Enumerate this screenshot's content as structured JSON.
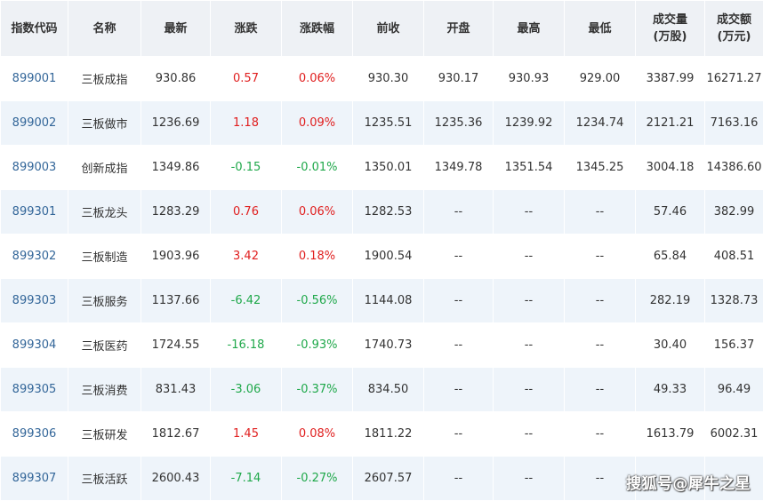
{
  "colors": {
    "up": "#e01e1e",
    "down": "#1fa84a",
    "code": "#336699",
    "header_bg": "#eef1f5",
    "stripe_bg": "#eef4fa"
  },
  "headers": [
    [
      "指数代码"
    ],
    [
      "名称"
    ],
    [
      "最新"
    ],
    [
      "涨跌"
    ],
    [
      "涨跌幅"
    ],
    [
      "前收"
    ],
    [
      "开盘"
    ],
    [
      "最高"
    ],
    [
      "最低"
    ],
    [
      "成交量",
      "(万股)"
    ],
    [
      "成交额",
      "(万元)"
    ]
  ],
  "rows": [
    [
      "899001",
      "三板成指",
      "930.86",
      "0.57",
      "0.06%",
      "930.30",
      "930.17",
      "930.93",
      "929.00",
      "3387.99",
      "16271.27"
    ],
    [
      "899002",
      "三板做市",
      "1236.69",
      "1.18",
      "0.09%",
      "1235.51",
      "1235.36",
      "1239.92",
      "1234.74",
      "2121.21",
      "7163.16"
    ],
    [
      "899003",
      "创新成指",
      "1349.86",
      "-0.15",
      "-0.01%",
      "1350.01",
      "1349.78",
      "1351.54",
      "1345.25",
      "3004.18",
      "14386.60"
    ],
    [
      "899301",
      "三板龙头",
      "1283.29",
      "0.76",
      "0.06%",
      "1282.53",
      "--",
      "--",
      "--",
      "57.46",
      "382.99"
    ],
    [
      "899302",
      "三板制造",
      "1903.96",
      "3.42",
      "0.18%",
      "1900.54",
      "--",
      "--",
      "--",
      "65.84",
      "408.51"
    ],
    [
      "899303",
      "三板服务",
      "1137.66",
      "-6.42",
      "-0.56%",
      "1144.08",
      "--",
      "--",
      "--",
      "282.19",
      "1328.73"
    ],
    [
      "899304",
      "三板医药",
      "1724.55",
      "-16.18",
      "-0.93%",
      "1740.73",
      "--",
      "--",
      "--",
      "30.40",
      "156.37"
    ],
    [
      "899305",
      "三板消费",
      "831.43",
      "-3.06",
      "-0.37%",
      "834.50",
      "--",
      "--",
      "--",
      "49.33",
      "96.49"
    ],
    [
      "899306",
      "三板研发",
      "1812.67",
      "1.45",
      "0.08%",
      "1811.22",
      "--",
      "--",
      "--",
      "1613.79",
      "6002.31"
    ],
    [
      "899307",
      "三板活跃",
      "2600.43",
      "-7.14",
      "-0.27%",
      "2607.57",
      "--",
      "--",
      "--",
      "",
      ""
    ]
  ],
  "watermark": "搜狐号@犀牛之星"
}
